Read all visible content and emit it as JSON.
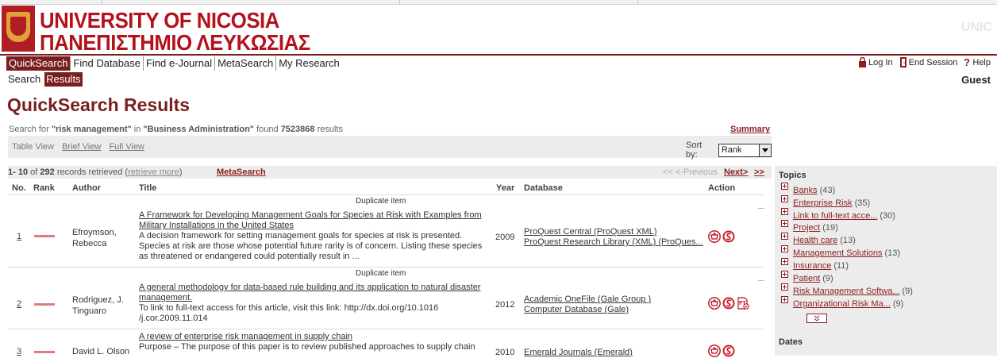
{
  "university": {
    "name_en": "UNIVERSITY OF NICOSIA",
    "name_gr": "ΠΑΝΕΠΙΣΤΗΜΙΟ ΛΕΥΚΩΣΙΑΣ",
    "watermark": "UNIC"
  },
  "nav": {
    "tabs": [
      "QuickSearch",
      "Find Database",
      "Find e-Journal",
      "MetaSearch",
      "My Research"
    ],
    "active": 0
  },
  "subnav": {
    "tabs": [
      "Search",
      "Results"
    ],
    "active": 1
  },
  "user": {
    "login": "Log In",
    "end_session": "End Session",
    "help": "Help",
    "guest": "Guest"
  },
  "page": {
    "title": "QuickSearch Results",
    "search_prefix": "Search for",
    "query": "\"risk management\"",
    "in_word": "in",
    "scope": "\"Business Administration\"",
    "found_word": "found",
    "count": "7523868",
    "results_word": "results",
    "summary_link": "Summary"
  },
  "views": {
    "table": "Table View",
    "brief": "Brief View",
    "full": "Full View"
  },
  "sort": {
    "label": "Sort by:",
    "value": "Rank"
  },
  "records": {
    "range": "1- 10",
    "of_word": "of",
    "total": "292",
    "retrieved_text": "records retrieved",
    "retrieve_more": "retrieve more",
    "metasearch": "MetaSearch",
    "previous": "<< <-Previous",
    "next": "Next>",
    "last": ">>"
  },
  "columns": {
    "no": "No.",
    "rank": "Rank",
    "author": "Author",
    "title": "Title",
    "year": "Year",
    "database": "Database",
    "action": "Action"
  },
  "duplicate_label": "Duplicate item",
  "results": [
    {
      "no": "1",
      "rank": 0.6,
      "author": [
        "Efroymson,",
        "Rebecca"
      ],
      "title": [
        "A Framework for Developing Management Goals for Species at Risk with Examples from",
        "Military Installations in the United States"
      ],
      "abstract": [
        "A decision framework for setting management goals for species at risk is presented.",
        "Species at risk are those whose potential future rarity is of concern. Listing these species",
        "as threatened or endangered could potentially result in ..."
      ],
      "year": "2009",
      "databases": [
        "ProQuest Central (ProQuest XML)",
        "ProQuest Research Library (XML) (ProQues..."
      ]
    },
    {
      "no": "2",
      "rank": 0.6,
      "author": [
        "Rodriguez, J.",
        "Tinguaro"
      ],
      "title": [
        "A general methodology for data-based rule building and its application to natural disaster",
        "management."
      ],
      "abstract": [
        "To link to full-text access for this article, visit this link: http://dx.doi.org/10.1016",
        "/j.cor.2009.11.014"
      ],
      "year": "2012",
      "databases": [
        "Academic OneFile (Gale Group )",
        "Computer Database (Gale)"
      ]
    },
    {
      "no": "3",
      "rank": 0.6,
      "author": [
        "David L. Olson"
      ],
      "title": [
        "A review of enterprise risk management in supply chain"
      ],
      "abstract": [
        "Purpose – The purpose of this paper is to review published approaches to supply chain"
      ],
      "year": "2010",
      "databases": [
        "Emerald Journals (Emerald)"
      ]
    }
  ],
  "sidebar": {
    "topics_heading": "Topics",
    "topics": [
      {
        "label": "Banks",
        "count": "(43)"
      },
      {
        "label": "Enterprise Risk",
        "count": "(35)"
      },
      {
        "label": "Link to full-text acce...",
        "count": "(30)"
      },
      {
        "label": "Project",
        "count": "(19)"
      },
      {
        "label": "Health care",
        "count": "(13)"
      },
      {
        "label": "Management Solutions",
        "count": "(13)"
      },
      {
        "label": "Insurance",
        "count": "(11)"
      },
      {
        "label": "Patient",
        "count": "(9)"
      },
      {
        "label": "Risk Management Softwa...",
        "count": "(9)"
      },
      {
        "label": "Organizational Risk Ma...",
        "count": "(9)"
      }
    ],
    "dates_heading": "Dates"
  },
  "colors": {
    "brand": "#7a1f1f",
    "link": "#8b1e1e",
    "logo_red": "#b3121b",
    "rank_bar": "#e07b7b"
  }
}
